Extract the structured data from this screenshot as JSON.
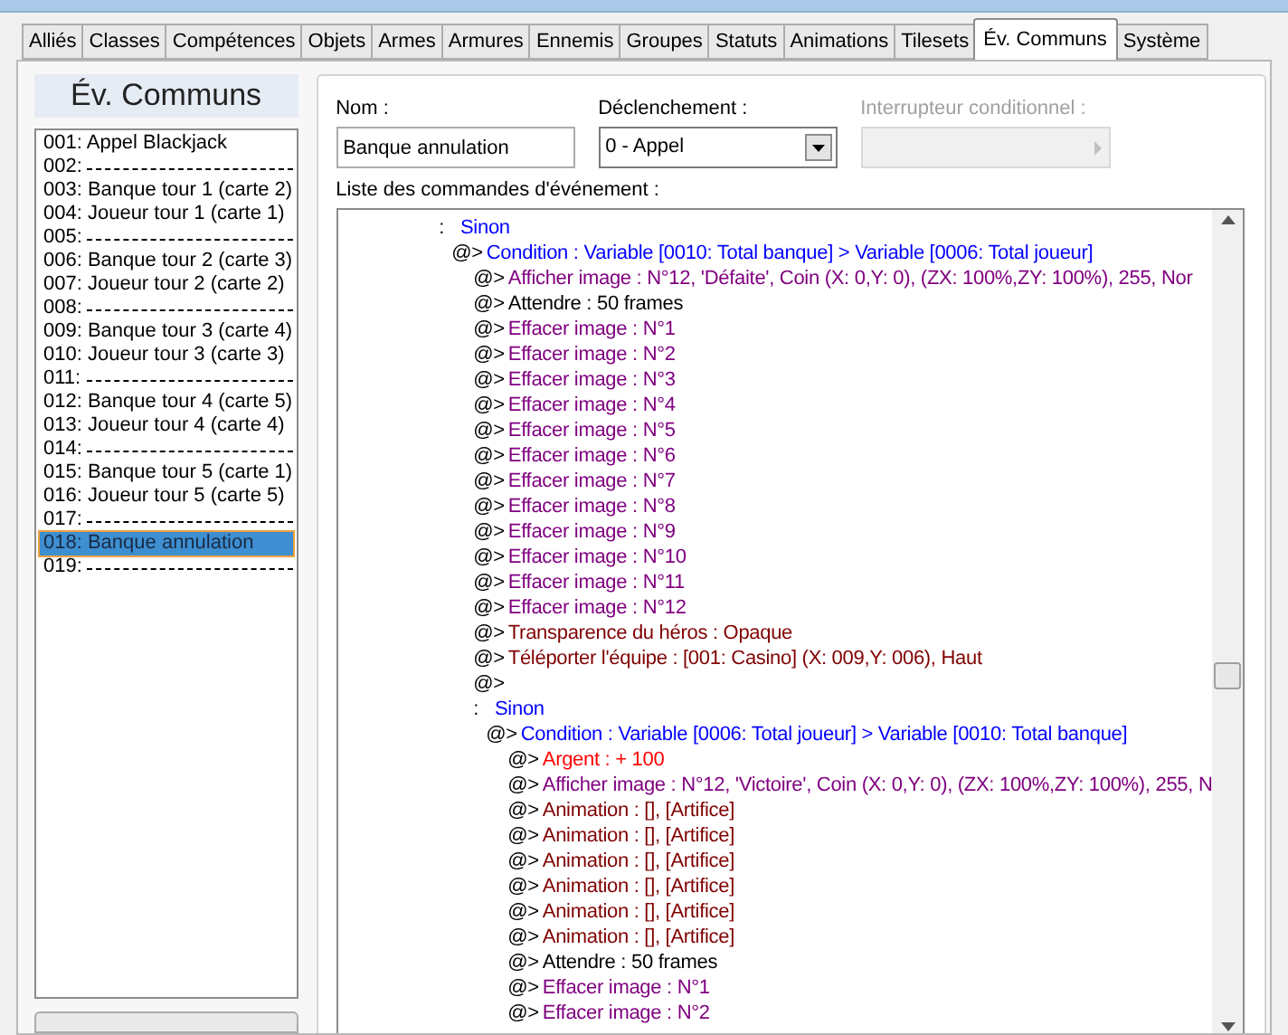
{
  "tabs": [
    {
      "label": "Alliés",
      "selected": false
    },
    {
      "label": "Classes",
      "selected": false
    },
    {
      "label": "Compétences",
      "selected": false
    },
    {
      "label": "Objets",
      "selected": false
    },
    {
      "label": "Armes",
      "selected": false
    },
    {
      "label": "Armures",
      "selected": false
    },
    {
      "label": "Ennemis",
      "selected": false
    },
    {
      "label": "Groupes",
      "selected": false
    },
    {
      "label": "Statuts",
      "selected": false
    },
    {
      "label": "Animations",
      "selected": false
    },
    {
      "label": "Tilesets",
      "selected": false
    },
    {
      "label": "Év. Communs",
      "selected": true
    },
    {
      "label": "Système",
      "selected": false
    }
  ],
  "sidebar": {
    "title": "Év. Communs",
    "items": [
      {
        "label": "001: Appel Blackjack",
        "kind": "named",
        "selected": false
      },
      {
        "label": "002:",
        "kind": "blank",
        "selected": false
      },
      {
        "label": "003: Banque tour 1 (carte 2)",
        "kind": "named",
        "selected": false
      },
      {
        "label": "004: Joueur tour 1 (carte 1)",
        "kind": "named",
        "selected": false
      },
      {
        "label": "005:",
        "kind": "blank",
        "selected": false
      },
      {
        "label": "006: Banque tour 2 (carte 3)",
        "kind": "named",
        "selected": false
      },
      {
        "label": "007: Joueur tour 2 (carte 2)",
        "kind": "named",
        "selected": false
      },
      {
        "label": "008:",
        "kind": "blank",
        "selected": false
      },
      {
        "label": "009: Banque tour 3 (carte 4)",
        "kind": "named",
        "selected": false
      },
      {
        "label": "010: Joueur tour 3 (carte 3)",
        "kind": "named",
        "selected": false
      },
      {
        "label": "011:",
        "kind": "blank",
        "selected": false
      },
      {
        "label": "012: Banque tour 4 (carte 5)",
        "kind": "named",
        "selected": false
      },
      {
        "label": "013: Joueur tour 4 (carte 4)",
        "kind": "named",
        "selected": false
      },
      {
        "label": "014:",
        "kind": "blank",
        "selected": false
      },
      {
        "label": "015: Banque tour 5 (carte 1)",
        "kind": "named",
        "selected": false
      },
      {
        "label": "016: Joueur tour 5 (carte 5)",
        "kind": "named",
        "selected": false
      },
      {
        "label": "017:",
        "kind": "blank",
        "selected": false
      },
      {
        "label": "018: Banque annulation",
        "kind": "named",
        "selected": true
      },
      {
        "label": "019:",
        "kind": "blank",
        "selected": false
      }
    ]
  },
  "form": {
    "name": {
      "label": "Nom :",
      "value": "Banque annulation"
    },
    "trigger": {
      "label": "Déclenchement :",
      "value": "0 - Appel"
    },
    "switch": {
      "label": "Interrupteur conditionnel :",
      "disabled": true
    },
    "commands_label": "Liste des commandes d'événement :",
    "commands": [
      {
        "kind": "branch",
        "marker": ":",
        "text": "Sinon",
        "color": "#0000ff",
        "children": [
          {
            "kind": "command",
            "marker": "@>",
            "text": "Condition : Variable [0010: Total banque] > Variable [0006: Total joueur]",
            "color": "#0000ff",
            "children": [
              {
                "kind": "command",
                "marker": "@>",
                "text": "Afficher image : N°12, 'Défaite', Coin (X: 0,Y: 0), (ZX: 100%,ZY: 100%), 255, Nor",
                "color": "#800080"
              },
              {
                "kind": "command",
                "marker": "@>",
                "text": "Attendre : 50 frames",
                "color": "#000000"
              },
              {
                "kind": "command",
                "marker": "@>",
                "text": "Effacer image : N°1",
                "color": "#800080"
              },
              {
                "kind": "command",
                "marker": "@>",
                "text": "Effacer image : N°2",
                "color": "#800080"
              },
              {
                "kind": "command",
                "marker": "@>",
                "text": "Effacer image : N°3",
                "color": "#800080"
              },
              {
                "kind": "command",
                "marker": "@>",
                "text": "Effacer image : N°4",
                "color": "#800080"
              },
              {
                "kind": "command",
                "marker": "@>",
                "text": "Effacer image : N°5",
                "color": "#800080"
              },
              {
                "kind": "command",
                "marker": "@>",
                "text": "Effacer image : N°6",
                "color": "#800080"
              },
              {
                "kind": "command",
                "marker": "@>",
                "text": "Effacer image : N°7",
                "color": "#800080"
              },
              {
                "kind": "command",
                "marker": "@>",
                "text": "Effacer image : N°8",
                "color": "#800080"
              },
              {
                "kind": "command",
                "marker": "@>",
                "text": "Effacer image : N°9",
                "color": "#800080"
              },
              {
                "kind": "command",
                "marker": "@>",
                "text": "Effacer image : N°10",
                "color": "#800080"
              },
              {
                "kind": "command",
                "marker": "@>",
                "text": "Effacer image : N°11",
                "color": "#800080"
              },
              {
                "kind": "command",
                "marker": "@>",
                "text": "Effacer image : N°12",
                "color": "#800080"
              },
              {
                "kind": "command",
                "marker": "@>",
                "text": "Transparence du héros : Opaque",
                "color": "#800000"
              },
              {
                "kind": "command",
                "marker": "@>",
                "text": "Téléporter l'équipe : [001: Casino] (X: 009,Y: 006), Haut",
                "color": "#800000"
              },
              {
                "kind": "empty",
                "marker": "@>"
              },
              {
                "kind": "branch",
                "marker": ":",
                "text": "Sinon",
                "color": "#0000ff",
                "children": [
                  {
                    "kind": "command",
                    "marker": "@>",
                    "text": "Condition : Variable [0006: Total joueur] > Variable [0010: Total banque]",
                    "color": "#0000ff",
                    "children": [
                      {
                        "kind": "command",
                        "marker": "@>",
                        "text": "Argent : + 100",
                        "color": "#ff0000"
                      },
                      {
                        "kind": "command",
                        "marker": "@>",
                        "text": "Afficher image : N°12, 'Victoire', Coin (X: 0,Y: 0), (ZX: 100%,ZY: 100%), 255, N",
                        "color": "#800080"
                      },
                      {
                        "kind": "command",
                        "marker": "@>",
                        "text": "Animation : [], [Artifice]",
                        "color": "#800000"
                      },
                      {
                        "kind": "command",
                        "marker": "@>",
                        "text": "Animation : [], [Artifice]",
                        "color": "#800000"
                      },
                      {
                        "kind": "command",
                        "marker": "@>",
                        "text": "Animation : [], [Artifice]",
                        "color": "#800000"
                      },
                      {
                        "kind": "command",
                        "marker": "@>",
                        "text": "Animation : [], [Artifice]",
                        "color": "#800000"
                      },
                      {
                        "kind": "command",
                        "marker": "@>",
                        "text": "Animation : [], [Artifice]",
                        "color": "#800000"
                      },
                      {
                        "kind": "command",
                        "marker": "@>",
                        "text": "Animation : [], [Artifice]",
                        "color": "#800000"
                      },
                      {
                        "kind": "command",
                        "marker": "@>",
                        "text": "Attendre : 50 frames",
                        "color": "#000000"
                      },
                      {
                        "kind": "command",
                        "marker": "@>",
                        "text": "Effacer image : N°1",
                        "color": "#800080"
                      },
                      {
                        "kind": "command",
                        "marker": "@>",
                        "text": "Effacer image : N°2",
                        "color": "#800080"
                      }
                    ]
                  }
                ]
              }
            ]
          }
        ]
      }
    ]
  }
}
